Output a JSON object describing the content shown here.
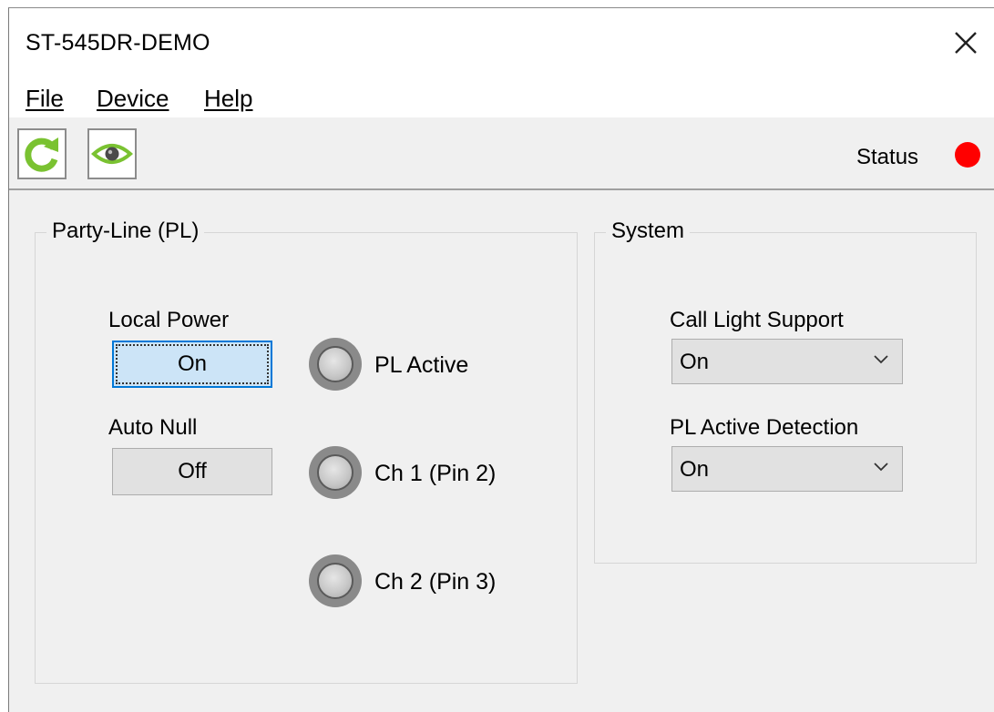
{
  "window": {
    "title": "ST-545DR-DEMO"
  },
  "menu": {
    "file": "File",
    "device": "Device",
    "help": "Help"
  },
  "toolbar": {
    "status_label": "Status",
    "status_color": "#ff0000"
  },
  "party_line": {
    "title": "Party-Line (PL)",
    "local_power_label": "Local Power",
    "local_power_value": "On",
    "auto_null_label": "Auto Null",
    "auto_null_value": "Off",
    "indicators": [
      "PL Active",
      "Ch 1 (Pin 2)",
      "Ch 2 (Pin 3)"
    ]
  },
  "system": {
    "title": "System",
    "call_light_label": "Call Light Support",
    "call_light_value": "On",
    "pl_active_detection_label": "PL Active Detection",
    "pl_active_detection_value": "On"
  }
}
